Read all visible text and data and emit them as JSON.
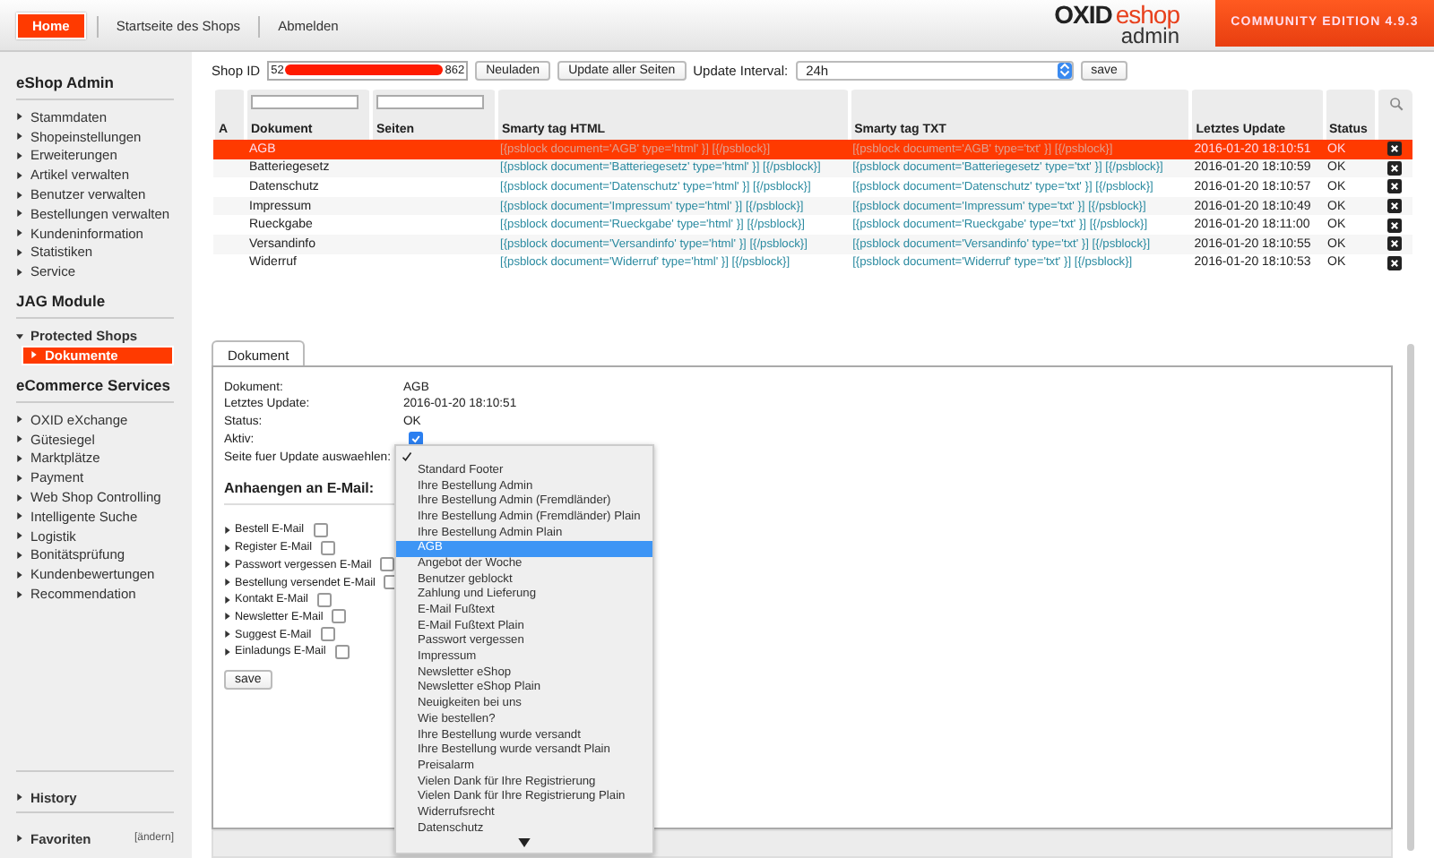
{
  "header": {
    "nav": [
      {
        "label": "Home",
        "selected": true
      },
      {
        "label": "Startseite des Shops",
        "selected": false
      },
      {
        "label": "Abmelden",
        "selected": false
      }
    ],
    "logo": {
      "brand": "OXID",
      "product": "eshop",
      "sub": "admin"
    },
    "edition": "COMMUNITY EDITION 4.9.3"
  },
  "sidebar": {
    "sections": [
      {
        "title": "eShop Admin",
        "items": [
          {
            "label": "Stammdaten",
            "expanded": false,
            "selected": false
          },
          {
            "label": "Shopeinstellungen",
            "expanded": false,
            "selected": false
          },
          {
            "label": "Erweiterungen",
            "expanded": false,
            "selected": false
          },
          {
            "label": "Artikel verwalten",
            "expanded": false,
            "selected": false
          },
          {
            "label": "Benutzer verwalten",
            "expanded": false,
            "selected": false
          },
          {
            "label": "Bestellungen verwalten",
            "expanded": false,
            "selected": false
          },
          {
            "label": "Kundeninformation",
            "expanded": false,
            "selected": false
          },
          {
            "label": "Statistiken",
            "expanded": false,
            "selected": false
          },
          {
            "label": "Service",
            "expanded": false,
            "selected": false
          }
        ]
      },
      {
        "title": "JAG Module",
        "items": [
          {
            "label": "Protected Shops",
            "expanded": true,
            "selected": false,
            "children": [
              {
                "label": "Dokumente",
                "selected": true
              }
            ]
          }
        ]
      },
      {
        "title": "eCommerce Services",
        "items": [
          {
            "label": "OXID eXchange",
            "expanded": false,
            "selected": false
          },
          {
            "label": "Gütesiegel",
            "expanded": false,
            "selected": false
          },
          {
            "label": "Marktplätze",
            "expanded": false,
            "selected": false
          },
          {
            "label": "Payment",
            "expanded": false,
            "selected": false
          },
          {
            "label": "Web Shop Controlling",
            "expanded": false,
            "selected": false
          },
          {
            "label": "Intelligente Suche",
            "expanded": false,
            "selected": false
          },
          {
            "label": "Logistik",
            "expanded": false,
            "selected": false
          },
          {
            "label": "Bonitätsprüfung",
            "expanded": false,
            "selected": false
          },
          {
            "label": "Kundenbewertungen",
            "expanded": false,
            "selected": false
          },
          {
            "label": "Recommendation",
            "expanded": false,
            "selected": false
          }
        ]
      }
    ],
    "history": "History",
    "favorites": "Favoriten",
    "favorites_edit": "[ändern]"
  },
  "toolbar": {
    "shop_id_label": "Shop ID",
    "shop_id_start": "52",
    "shop_id_end": "862",
    "reload": "Neuladen",
    "update_all": "Update aller Seiten",
    "interval_label": "Update Interval:",
    "interval": "24h",
    "save": "save"
  },
  "table": {
    "columns": [
      "A",
      "Dokument",
      "Seiten",
      "Smarty tag HTML",
      "Smarty tag TXT",
      "Letztes Update",
      "Status"
    ],
    "rows": [
      {
        "dokument": "AGB",
        "html": "[{psblock document='AGB' type='html' }] [{/psblock}]",
        "txt": "[{psblock document='AGB' type='txt' }] [{/psblock}]",
        "updated": "2016-01-20 18:10:51",
        "status": "OK",
        "selected": true
      },
      {
        "dokument": "Batteriegesetz",
        "html": "[{psblock document='Batteriegesetz' type='html' }] [{/psblock}]",
        "txt": "[{psblock document='Batteriegesetz' type='txt' }] [{/psblock}]",
        "updated": "2016-01-20 18:10:59",
        "status": "OK",
        "selected": false
      },
      {
        "dokument": "Datenschutz",
        "html": "[{psblock document='Datenschutz' type='html' }] [{/psblock}]",
        "txt": "[{psblock document='Datenschutz' type='txt' }] [{/psblock}]",
        "updated": "2016-01-20 18:10:57",
        "status": "OK",
        "selected": false
      },
      {
        "dokument": "Impressum",
        "html": "[{psblock document='Impressum' type='html' }] [{/psblock}]",
        "txt": "[{psblock document='Impressum' type='txt' }] [{/psblock}]",
        "updated": "2016-01-20 18:10:49",
        "status": "OK",
        "selected": false
      },
      {
        "dokument": "Rueckgabe",
        "html": "[{psblock document='Rueckgabe' type='html' }] [{/psblock}]",
        "txt": "[{psblock document='Rueckgabe' type='txt' }] [{/psblock}]",
        "updated": "2016-01-20 18:11:00",
        "status": "OK",
        "selected": false
      },
      {
        "dokument": "Versandinfo",
        "html": "[{psblock document='Versandinfo' type='html' }] [{/psblock}]",
        "txt": "[{psblock document='Versandinfo' type='txt' }] [{/psblock}]",
        "updated": "2016-01-20 18:10:55",
        "status": "OK",
        "selected": false
      },
      {
        "dokument": "Widerruf",
        "html": "[{psblock document='Widerruf' type='html' }] [{/psblock}]",
        "txt": "[{psblock document='Widerruf' type='txt' }] [{/psblock}]",
        "updated": "2016-01-20 18:10:53",
        "status": "OK",
        "selected": false
      }
    ]
  },
  "detail": {
    "tab": "Dokument",
    "fields": [
      {
        "label": "Dokument:",
        "value": "AGB"
      },
      {
        "label": "Letztes Update:",
        "value": "2016-01-20 18:10:51"
      },
      {
        "label": "Status:",
        "value": "OK"
      }
    ],
    "active_label": "Aktiv:",
    "active": true,
    "page_select_label": "Seite fuer Update auswaehlen:",
    "attach_title": "Anhaengen an E-Mail:",
    "emails": [
      {
        "label": "Bestell E-Mail",
        "checked": false
      },
      {
        "label": "Register E-Mail",
        "checked": false
      },
      {
        "label": "Passwort vergessen E-Mail",
        "checked": false
      },
      {
        "label": "Bestellung versendet E-Mail",
        "checked": false
      },
      {
        "label": "Kontakt E-Mail",
        "checked": false
      },
      {
        "label": "Newsletter E-Mail",
        "checked": false
      },
      {
        "label": "Suggest E-Mail",
        "checked": false
      },
      {
        "label": "Einladungs E-Mail",
        "checked": false
      }
    ],
    "save": "save"
  },
  "dropdown": {
    "options": [
      {
        "selected": true,
        "highlighted": false
      },
      {
        "label": "Standard Footer",
        "selected": false,
        "highlighted": false
      },
      {
        "label": "Ihre Bestellung Admin",
        "selected": false,
        "highlighted": false
      },
      {
        "label": "Ihre Bestellung Admin (Fremdländer)",
        "selected": false,
        "highlighted": false
      },
      {
        "label": "Ihre Bestellung Admin (Fremdländer) Plain",
        "selected": false,
        "highlighted": false
      },
      {
        "label": "Ihre Bestellung Admin Plain",
        "selected": false,
        "highlighted": false
      },
      {
        "label": "AGB",
        "selected": false,
        "highlighted": true
      },
      {
        "label": "Angebot der Woche",
        "selected": false,
        "highlighted": false
      },
      {
        "label": "Benutzer geblockt",
        "selected": false,
        "highlighted": false
      },
      {
        "label": "Zahlung und Lieferung",
        "selected": false,
        "highlighted": false
      },
      {
        "label": "E-Mail Fußtext",
        "selected": false,
        "highlighted": false
      },
      {
        "label": "E-Mail Fußtext Plain",
        "selected": false,
        "highlighted": false
      },
      {
        "label": "Passwort vergessen",
        "selected": false,
        "highlighted": false
      },
      {
        "label": "Impressum",
        "selected": false,
        "highlighted": false
      },
      {
        "label": "Newsletter eShop",
        "selected": false,
        "highlighted": false
      },
      {
        "label": "Newsletter eShop Plain",
        "selected": false,
        "highlighted": false
      },
      {
        "label": "Neuigkeiten bei uns",
        "selected": false,
        "highlighted": false
      },
      {
        "label": "Wie bestellen?",
        "selected": false,
        "highlighted": false
      },
      {
        "label": "Ihre Bestellung wurde versandt",
        "selected": false,
        "highlighted": false
      },
      {
        "label": "Ihre Bestellung wurde versandt Plain",
        "selected": false,
        "highlighted": false
      },
      {
        "label": "Preisalarm",
        "selected": false,
        "highlighted": false
      },
      {
        "label": "Vielen Dank für Ihre Registrierung",
        "selected": false,
        "highlighted": false
      },
      {
        "label": "Vielen Dank für Ihre Registrierung Plain",
        "selected": false,
        "highlighted": false
      },
      {
        "label": "Widerrufsrecht",
        "selected": false,
        "highlighted": false
      },
      {
        "label": "Datenschutz",
        "selected": false,
        "highlighted": false
      }
    ]
  }
}
